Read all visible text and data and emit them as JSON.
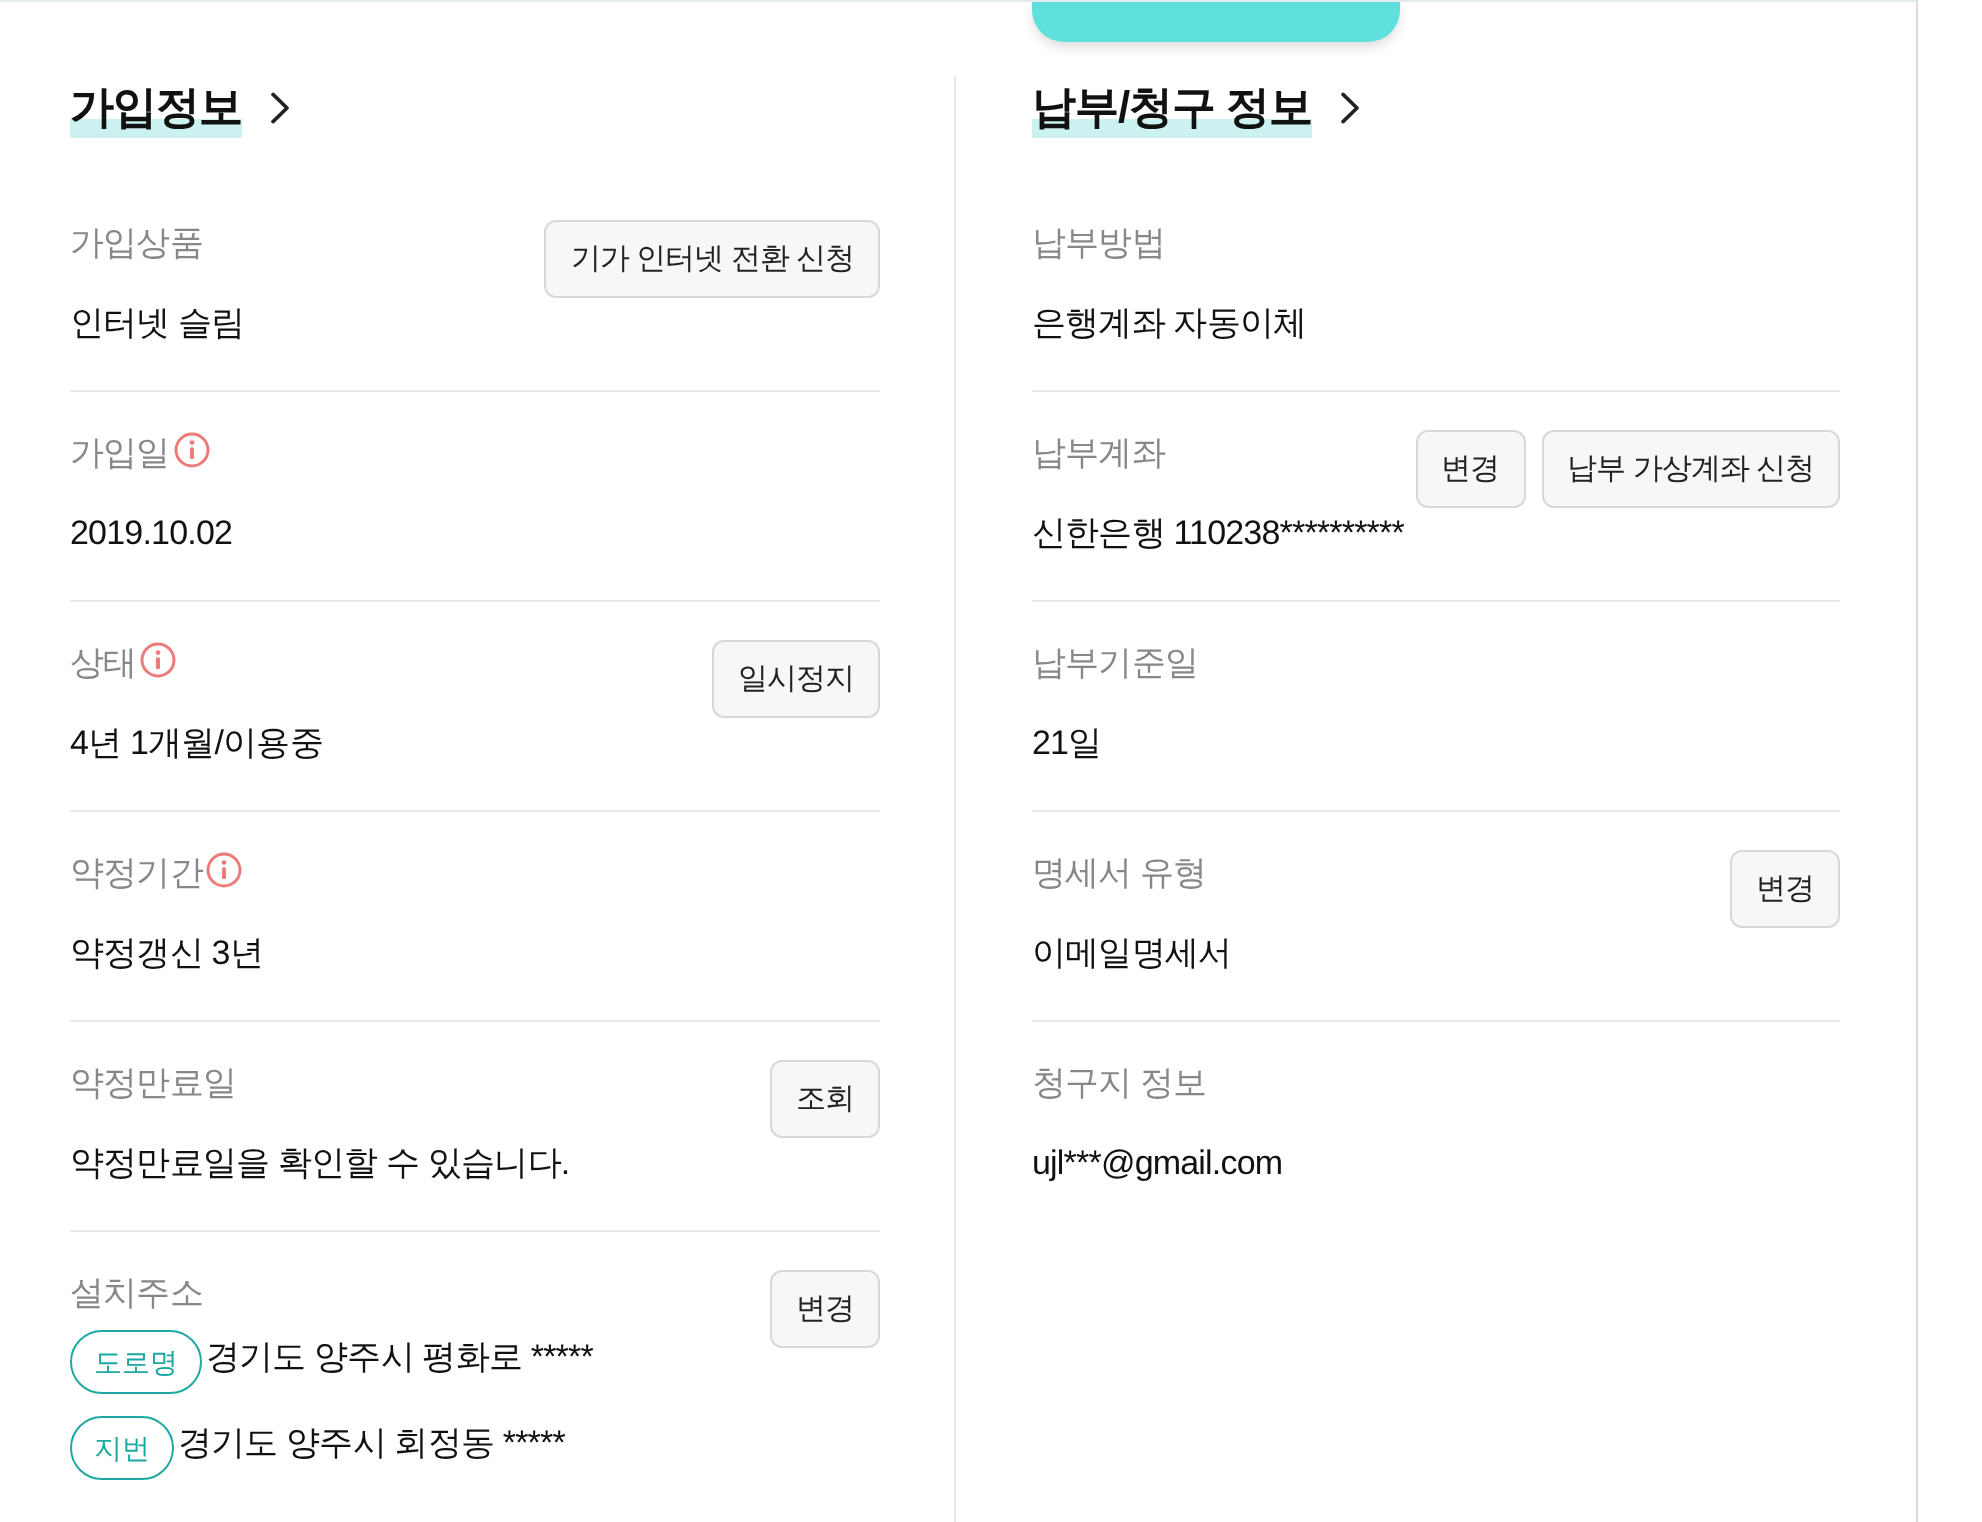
{
  "floating_button": {
    "visible": true
  },
  "sections": [
    {
      "title": "가입정보",
      "rows": [
        {
          "kind": "text",
          "label": "가입상품",
          "info": false,
          "buttons": [
            "기가 인터넷 전환 신청"
          ],
          "value": "인터넷 슬림"
        },
        {
          "kind": "text",
          "label": "가입일",
          "info": true,
          "buttons": [],
          "value": "2019.10.02"
        },
        {
          "kind": "text",
          "label": "상태",
          "info": true,
          "buttons": [
            "일시정지"
          ],
          "value": "4년 1개월/이용중"
        },
        {
          "kind": "text",
          "label": "약정기간",
          "info": true,
          "buttons": [],
          "value": "약정갱신 3년"
        },
        {
          "kind": "text",
          "label": "약정만료일",
          "info": false,
          "buttons": [
            "조회"
          ],
          "value": "약정만료일을 확인할 수 있습니다."
        },
        {
          "kind": "address",
          "label": "설치주소",
          "info": false,
          "buttons": [
            "변경"
          ],
          "lines": [
            {
              "tag": "도로명",
              "text": "경기도 양주시 평화로 *****"
            },
            {
              "tag": "지번",
              "text": "경기도 양주시 회정동 *****"
            }
          ]
        }
      ]
    },
    {
      "title": "납부/청구 정보",
      "rows": [
        {
          "kind": "text",
          "label": "납부방법",
          "info": false,
          "buttons": [],
          "value": "은행계좌 자동이체"
        },
        {
          "kind": "text",
          "label": "납부계좌",
          "info": false,
          "buttons": [
            "변경",
            "납부 가상계좌 신청"
          ],
          "value": "신한은행 110238**********"
        },
        {
          "kind": "text",
          "label": "납부기준일",
          "info": false,
          "buttons": [],
          "value": "21일"
        },
        {
          "kind": "text",
          "label": "명세서 유형",
          "info": false,
          "buttons": [
            "변경"
          ],
          "value": "이메일명세서"
        },
        {
          "kind": "text",
          "label": "청구지 정보",
          "info": false,
          "buttons": [],
          "value": "ujl***@gmail.com"
        }
      ]
    }
  ]
}
